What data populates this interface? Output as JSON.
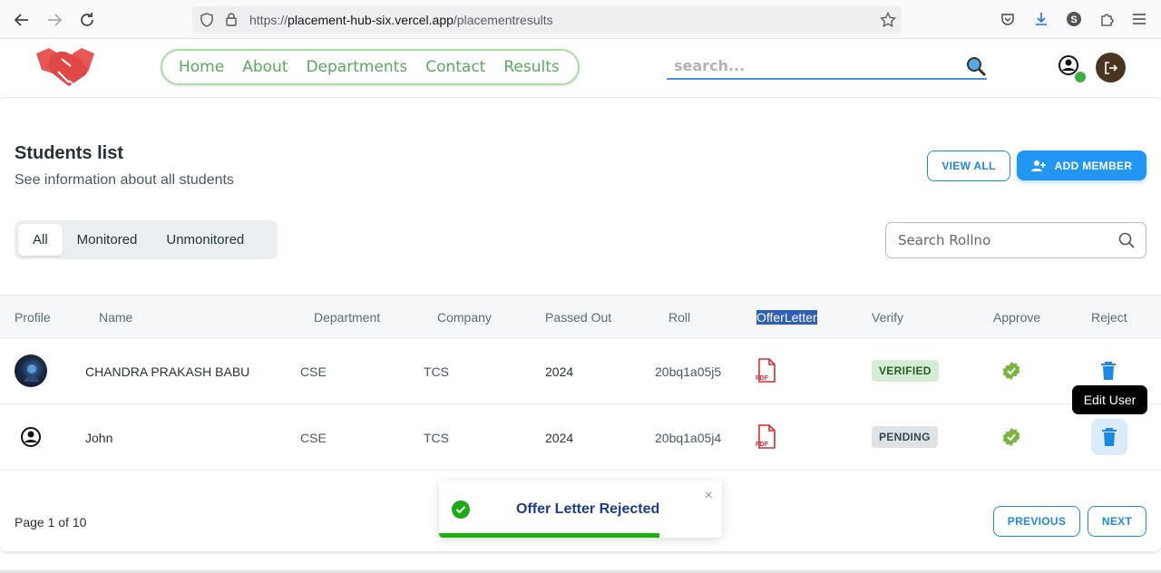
{
  "browser": {
    "url_prefix": "https://",
    "url_host": "placement-hub-six.vercel.app",
    "url_path": "/placementresults"
  },
  "header": {
    "nav": [
      "Home",
      "About",
      "Departments",
      "Contact",
      "Results"
    ],
    "search_placeholder": "search..."
  },
  "page": {
    "title": "Students list",
    "subtitle": "See information about all students",
    "view_all": "VIEW ALL",
    "add_member": "ADD MEMBER",
    "tabs": [
      "All",
      "Monitored",
      "Unmonitored"
    ],
    "active_tab": "All",
    "roll_search_placeholder": "Search Rollno"
  },
  "table": {
    "headers": [
      "Profile",
      "Name",
      "Department",
      "Company",
      "Passed Out",
      "Roll",
      "OfferLetter",
      "Verify",
      "Approve",
      "Reject"
    ],
    "rows": [
      {
        "name": "CHANDRA PRAKASH BABU",
        "department": "CSE",
        "company": "TCS",
        "passed_out": "2024",
        "roll": "20bq1a05j5",
        "status": "VERIFIED"
      },
      {
        "name": "John",
        "department": "CSE",
        "company": "TCS",
        "passed_out": "2024",
        "roll": "20bq1a05j4",
        "status": "PENDING"
      }
    ],
    "pdf_label": "PDF"
  },
  "tooltip": "Edit User",
  "pagination": {
    "label": "Page 1 of 10",
    "previous": "PREVIOUS",
    "next": "NEXT"
  },
  "toast": {
    "message": "Offer Letter Rejected",
    "close": "×",
    "progress": 0.78
  }
}
